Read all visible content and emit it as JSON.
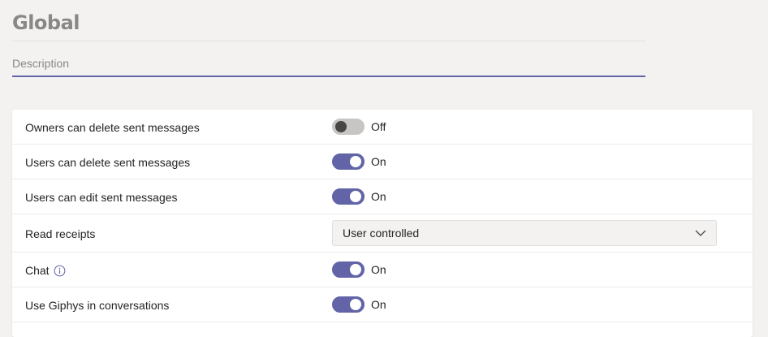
{
  "header": {
    "title": "Global",
    "description_placeholder": "Description",
    "description_value": ""
  },
  "settings": [
    {
      "label": "Owners can delete sent messages",
      "type": "toggle",
      "state": "Off"
    },
    {
      "label": "Users can delete sent messages",
      "type": "toggle",
      "state": "On"
    },
    {
      "label": "Users can edit sent messages",
      "type": "toggle",
      "state": "On"
    },
    {
      "label": "Read receipts",
      "type": "dropdown",
      "value": "User controlled"
    },
    {
      "label": "Chat",
      "type": "toggle",
      "state": "On",
      "has_info_icon": true
    },
    {
      "label": "Use Giphys in conversations",
      "type": "toggle",
      "state": "On"
    }
  ],
  "colors": {
    "accent": "#6264a7",
    "toggle_off_track": "#c8c6c4",
    "title": "#8a8886",
    "background": "#f3f2f1"
  }
}
